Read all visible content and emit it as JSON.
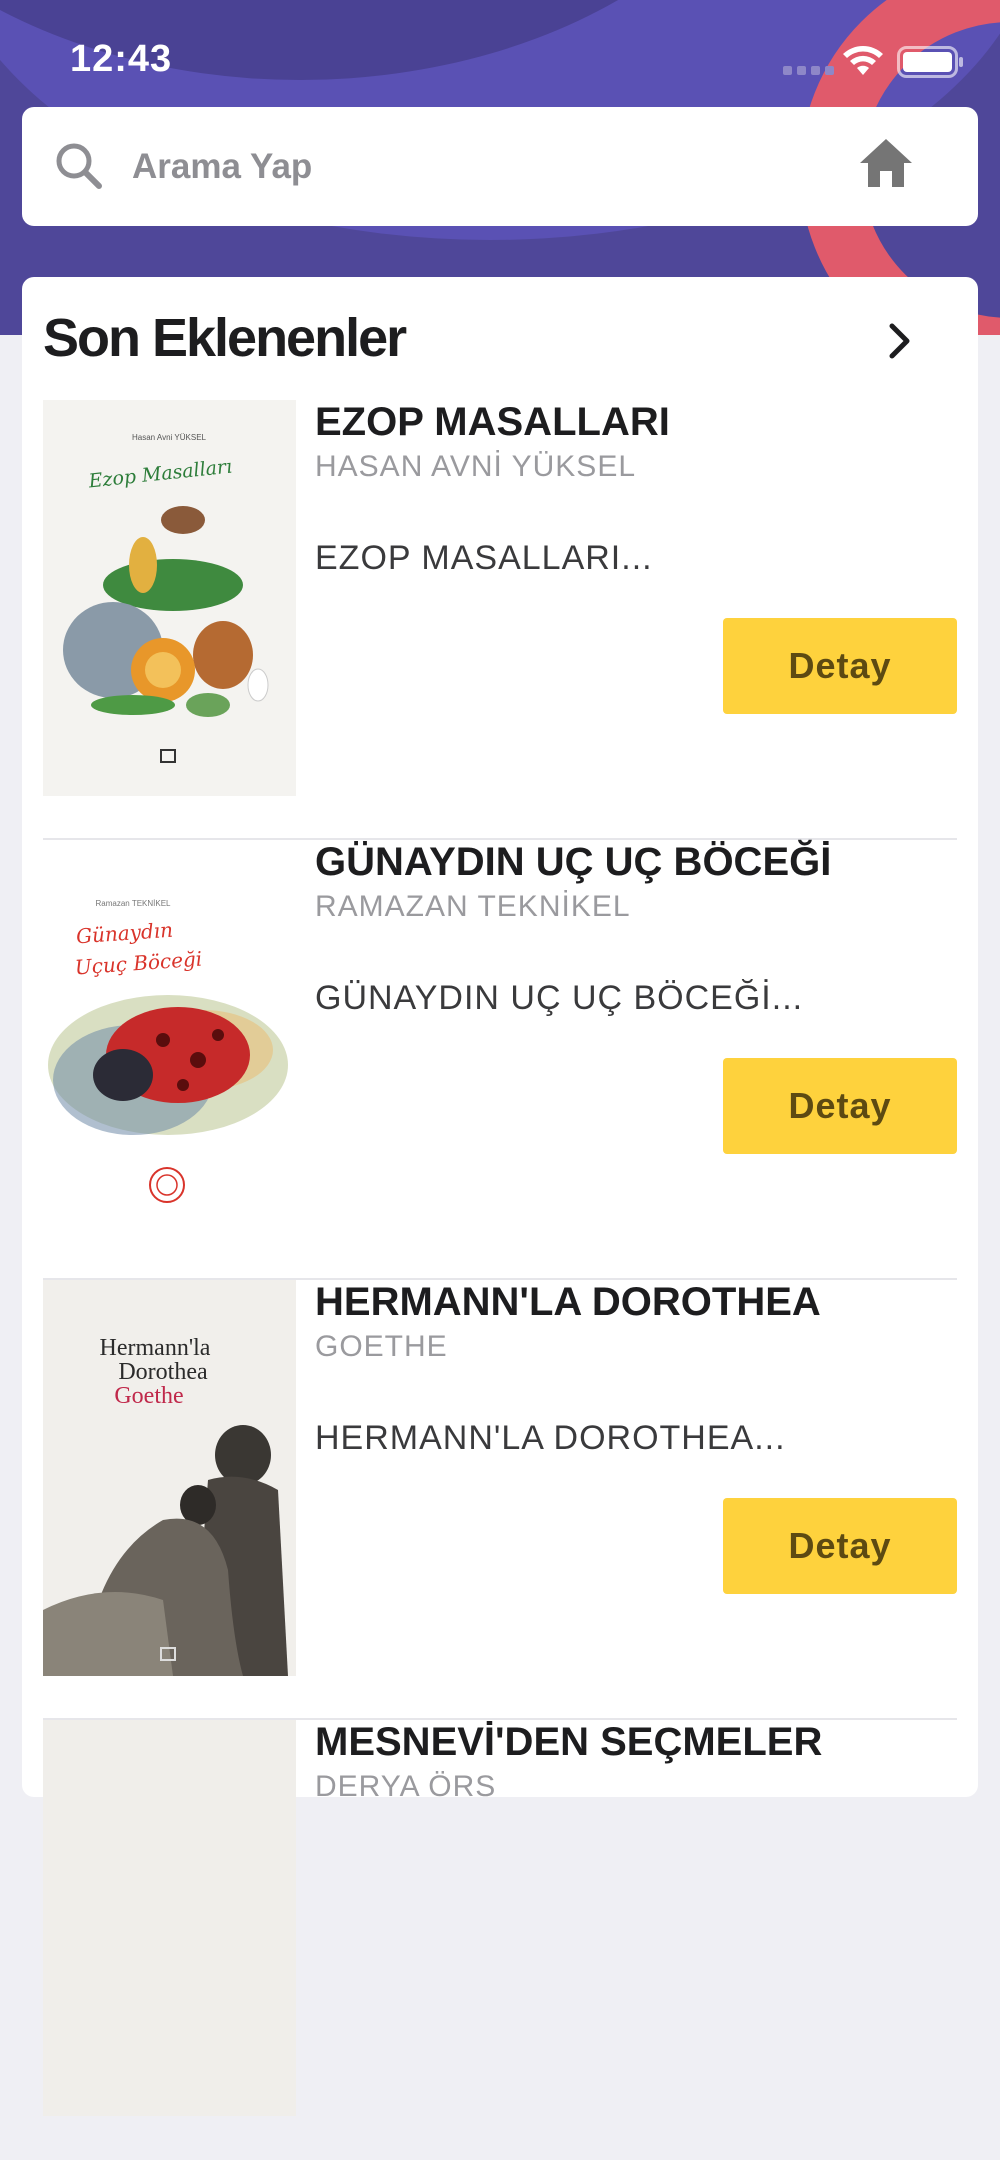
{
  "status_bar": {
    "time": "12:43"
  },
  "search": {
    "placeholder": "Arama Yap"
  },
  "section": {
    "title": "Son Eklenenler"
  },
  "books": [
    {
      "title": "EZOP MASALLARI",
      "author": "HASAN AVNİ YÜKSEL",
      "description": "EZOP MASALLARI...",
      "button": "Detay",
      "cover_author": "Hasan Avni YÜKSEL",
      "cover_title": "Ezop Masalları"
    },
    {
      "title": "GÜNAYDIN UÇ UÇ BÖCEĞİ",
      "author": "RAMAZAN TEKNİKEL",
      "description": "GÜNAYDIN UÇ UÇ BÖCEĞİ...",
      "button": "Detay",
      "cover_author": "Ramazan TEKNİKEL",
      "cover_title_1": "Günaydın",
      "cover_title_2": "Uçuç Böceği"
    },
    {
      "title": "HERMANN'LA DOROTHEA",
      "author": "GOETHE",
      "description": "HERMANN'LA DOROTHEA...",
      "button": "Detay",
      "cover_title_1": "Hermann'la",
      "cover_title_2": "Dorothea",
      "cover_author": "Goethe"
    },
    {
      "title": "MESNEVİ'DEN SEÇMELER",
      "author": "DERYA ÖRS"
    }
  ],
  "colors": {
    "header": "#4f4799",
    "accent_ring": "#e05a6b",
    "button": "#fed23d"
  }
}
